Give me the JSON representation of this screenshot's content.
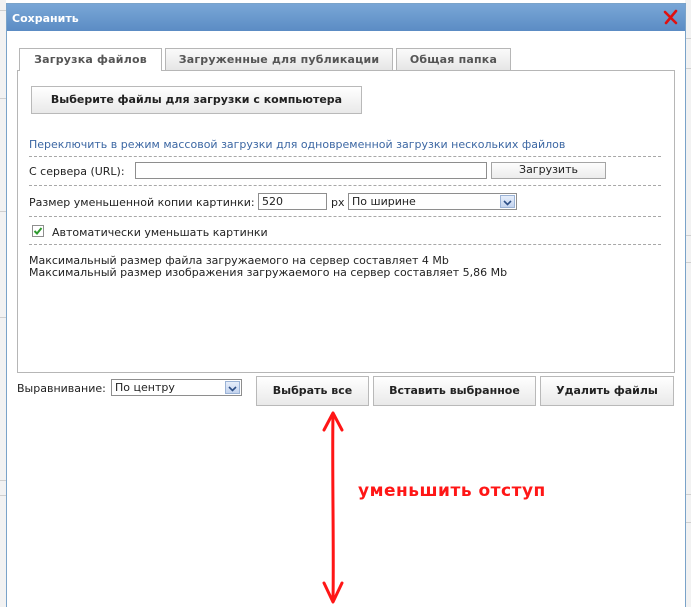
{
  "dialog": {
    "title": "Сохранить",
    "close_icon": "close-x-icon"
  },
  "tabs": [
    {
      "label": "Загрузка файлов",
      "active": true
    },
    {
      "label": "Загруженные для публикации",
      "active": false
    },
    {
      "label": "Общая папка",
      "active": false
    }
  ],
  "upload": {
    "choose_files_label": "Выберите файлы для загрузки с компьютера",
    "bulk_mode_link": "Переключить в режим массовой загрузки для одновременной загрузки нескольких файлов",
    "server_url_label": "С сервера (URL):",
    "server_url_value": "",
    "load_button": "Загрузить",
    "thumb_size_label": "Размер уменьшенной копии картинки:",
    "thumb_size_value": "520",
    "thumb_unit": "px",
    "thumb_mode_selected": "По ширине",
    "auto_shrink_checked": true,
    "auto_shrink_label": "Автоматически уменьшать картинки",
    "max_file_size_text": "Максимальный размер файла загружаемого на сервер составляет 4 Mb",
    "max_image_size_text": "Максимальный размер изображения загружаемого на сервер составляет 5,86 Mb"
  },
  "footer": {
    "alignment_label": "Выравнивание:",
    "alignment_selected": "По центру",
    "select_all_button": "Выбрать все",
    "insert_selected_button": "Вставить выбранное",
    "delete_files_button": "Удалить файлы"
  },
  "annotation": {
    "text": "уменьшить отступ",
    "color": "#ff1616"
  },
  "colors": {
    "titlebar": "#5b8cc4",
    "link": "#3c67a3"
  }
}
